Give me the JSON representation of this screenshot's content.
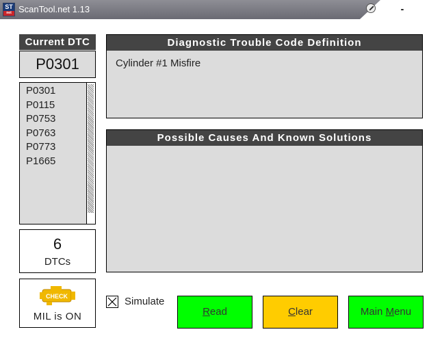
{
  "window": {
    "title": "ScanTool.net 1.13",
    "logo_top": "ST",
    "logo_bottom": "net",
    "minimize_label": "-"
  },
  "current_dtc": {
    "header": "Current DTC",
    "code": "P0301"
  },
  "dtc_list": [
    "P0301",
    "P0115",
    "P0753",
    "P0763",
    "P0773",
    "P1665"
  ],
  "count": {
    "value": "6",
    "label": "DTCs"
  },
  "mil": {
    "icon_text": "CHECK",
    "status": "MIL is ON"
  },
  "definition": {
    "header": "Diagnostic Trouble Code Definition",
    "text": "Cylinder #1 Misfire"
  },
  "causes": {
    "header": "Possible Causes And Known Solutions",
    "text": ""
  },
  "simulate": {
    "label": "Simulate",
    "checked": true
  },
  "buttons": {
    "read": {
      "accel": "R",
      "rest": "ead",
      "color": "#00ff00"
    },
    "clear": {
      "accel": "C",
      "rest": "lear",
      "color": "#ffcc00"
    },
    "main_menu": {
      "pre": "Main ",
      "accel": "M",
      "rest": "enu",
      "color": "#00ff00"
    }
  }
}
